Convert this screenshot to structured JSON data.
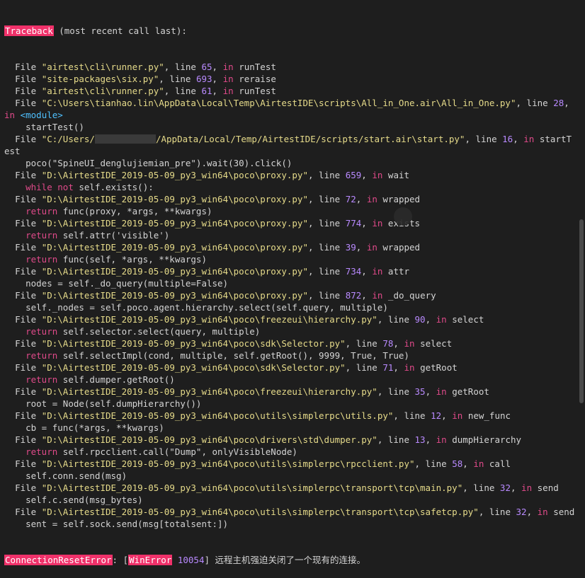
{
  "colors": {
    "background": "#1e1e1e",
    "traceback_highlight": "#f0316a",
    "string": "#e6db8a",
    "number": "#b98aff",
    "keyword": "#e04a8a"
  },
  "header": {
    "traceback_label": "Traceback",
    "recent_call": " (most recent call last):"
  },
  "frames": [
    {
      "file": "\"airtest\\cli\\runner.py\"",
      "line": "65",
      "func": "runTest"
    },
    {
      "file": "\"site-packages\\six.py\"",
      "line": "693",
      "func": "reraise"
    },
    {
      "file": "\"airtest\\cli\\runner.py\"",
      "line": "61",
      "func": "runTest"
    },
    {
      "file": "\"C:\\Users\\tianhao.lin\\AppData\\Local\\Temp\\AirtestIDE\\scripts\\All_in_One.air\\All_in_One.py\"",
      "line": "28",
      "func": "<module>",
      "code": "startTest()"
    },
    {
      "file_prefix": "\"C:/Users/",
      "file_suffix": "/AppData/Local/Temp/AirtestIDE/scripts/start.air\\start.py\"",
      "line": "16",
      "func": "startTest",
      "code": "poco(\"SpineUI_denglujiemian_pre\").wait(30).click()"
    },
    {
      "file": "\"D:\\AirtestIDE_2019-05-09_py3_win64\\poco\\proxy.py\"",
      "line": "659",
      "func": "wait",
      "code": "while not self.exists():"
    },
    {
      "file": "\"D:\\AirtestIDE_2019-05-09_py3_win64\\poco\\proxy.py\"",
      "line": "72",
      "func": "wrapped",
      "code": "return func(proxy, *args, **kwargs)"
    },
    {
      "file": "\"D:\\AirtestIDE_2019-05-09_py3_win64\\poco\\proxy.py\"",
      "line": "774",
      "func": "exists",
      "code": "return self.attr('visible')"
    },
    {
      "file": "\"D:\\AirtestIDE_2019-05-09_py3_win64\\poco\\proxy.py\"",
      "line": "39",
      "func": "wrapped",
      "code": "return func(self, *args, **kwargs)"
    },
    {
      "file": "\"D:\\AirtestIDE_2019-05-09_py3_win64\\poco\\proxy.py\"",
      "line": "734",
      "func": "attr",
      "code": "nodes = self._do_query(multiple=False)"
    },
    {
      "file": "\"D:\\AirtestIDE_2019-05-09_py3_win64\\poco\\proxy.py\"",
      "line": "872",
      "func": "_do_query",
      "code": "self._nodes = self.poco.agent.hierarchy.select(self.query, multiple)"
    },
    {
      "file": "\"D:\\AirtestIDE_2019-05-09_py3_win64\\poco\\freezeui\\hierarchy.py\"",
      "line": "90",
      "func": "select",
      "code": "return self.selector.select(query, multiple)"
    },
    {
      "file": "\"D:\\AirtestIDE_2019-05-09_py3_win64\\poco\\sdk\\Selector.py\"",
      "line": "78",
      "func": "select",
      "code": "return self.selectImpl(cond, multiple, self.getRoot(), 9999, True, True)"
    },
    {
      "file": "\"D:\\AirtestIDE_2019-05-09_py3_win64\\poco\\sdk\\Selector.py\"",
      "line": "71",
      "func": "getRoot",
      "code": "return self.dumper.getRoot()"
    },
    {
      "file": "\"D:\\AirtestIDE_2019-05-09_py3_win64\\poco\\freezeui\\hierarchy.py\"",
      "line": "35",
      "func": "getRoot",
      "code": "root = Node(self.dumpHierarchy())"
    },
    {
      "file": "\"D:\\AirtestIDE_2019-05-09_py3_win64\\poco\\utils\\simplerpc\\utils.py\"",
      "line": "12",
      "func": "new_func",
      "code": "cb = func(*args, **kwargs)"
    },
    {
      "file": "\"D:\\AirtestIDE_2019-05-09_py3_win64\\poco\\drivers\\std\\dumper.py\"",
      "line": "13",
      "func": "dumpHierarchy",
      "code": "return self.rpcclient.call(\"Dump\", onlyVisibleNode)"
    },
    {
      "file": "\"D:\\AirtestIDE_2019-05-09_py3_win64\\poco\\utils\\simplerpc\\rpcclient.py\"",
      "line": "58",
      "func": "call",
      "code": "self.conn.send(msg)"
    },
    {
      "file": "\"D:\\AirtestIDE_2019-05-09_py3_win64\\poco\\utils\\simplerpc\\transport\\tcp\\main.py\"",
      "line": "32",
      "func": "send",
      "code": "self.c.send(msg_bytes)"
    },
    {
      "file": "\"D:\\AirtestIDE_2019-05-09_py3_win64\\poco\\utils\\simplerpc\\transport\\tcp\\safetcp.py\"",
      "line": "32",
      "func": "send",
      "code": "sent = self.sock.send(msg[totalsent:])"
    }
  ],
  "error": {
    "type": "ConnectionResetError",
    "sep": ": [",
    "winerror_label": "WinError",
    "code": "10054",
    "message": "] 远程主机强迫关闭了一个现有的连接。"
  },
  "labels": {
    "file_kw": "  File ",
    "line_kw": ", line ",
    "in_kw": "in"
  }
}
